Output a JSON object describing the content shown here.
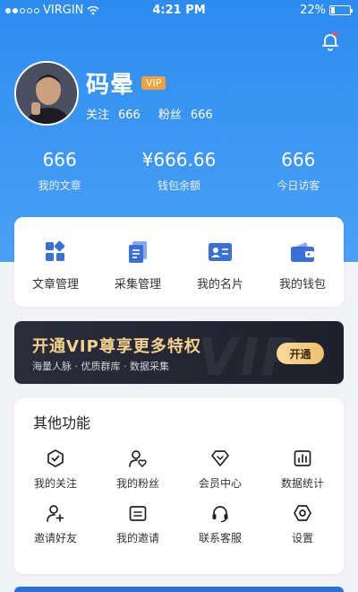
{
  "status_bar": {
    "carrier": "VIRGIN",
    "time": "4:21 PM",
    "battery": "22%",
    "battery_level": 0.22
  },
  "profile": {
    "name": "码晕",
    "vip_badge": "VIP",
    "follow_label": "关注",
    "follow_count": "666",
    "fans_label": "粉丝",
    "fans_count": "666"
  },
  "stats": [
    {
      "value": "666",
      "label": "我的文章"
    },
    {
      "value": "¥666.66",
      "label": "钱包余额"
    },
    {
      "value": "666",
      "label": "今日访客"
    }
  ],
  "quick_actions": [
    {
      "label": "文章管理",
      "icon": "grid-apps-icon"
    },
    {
      "label": "采集管理",
      "icon": "document-stack-icon"
    },
    {
      "label": "我的名片",
      "icon": "id-card-icon"
    },
    {
      "label": "我的钱包",
      "icon": "wallet-icon"
    }
  ],
  "vip_banner": {
    "title": "开通VIP尊享更多特权",
    "subtitle": "海量人脉 · 优质群库 · 数据采集",
    "watermark": "VIP",
    "button": "开通"
  },
  "other_functions": {
    "title": "其他功能",
    "items": [
      {
        "label": "我的关注",
        "icon": "check-shield-icon"
      },
      {
        "label": "我的粉丝",
        "icon": "user-heart-icon"
      },
      {
        "label": "会员中心",
        "icon": "diamond-icon"
      },
      {
        "label": "数据统计",
        "icon": "bar-chart-icon"
      },
      {
        "label": "邀请好友",
        "icon": "user-add-icon"
      },
      {
        "label": "我的邀请",
        "icon": "invite-card-icon"
      },
      {
        "label": "联系客服",
        "icon": "headset-icon"
      },
      {
        "label": "设置",
        "icon": "settings-icon"
      }
    ]
  },
  "colors": {
    "brand_blue": "#2e8cf0",
    "icon_blue": "#3b6fd8",
    "vip_gold": "#f2d18c",
    "badge_orange": "#f0a13a",
    "notification_red": "#ff4d4f"
  }
}
